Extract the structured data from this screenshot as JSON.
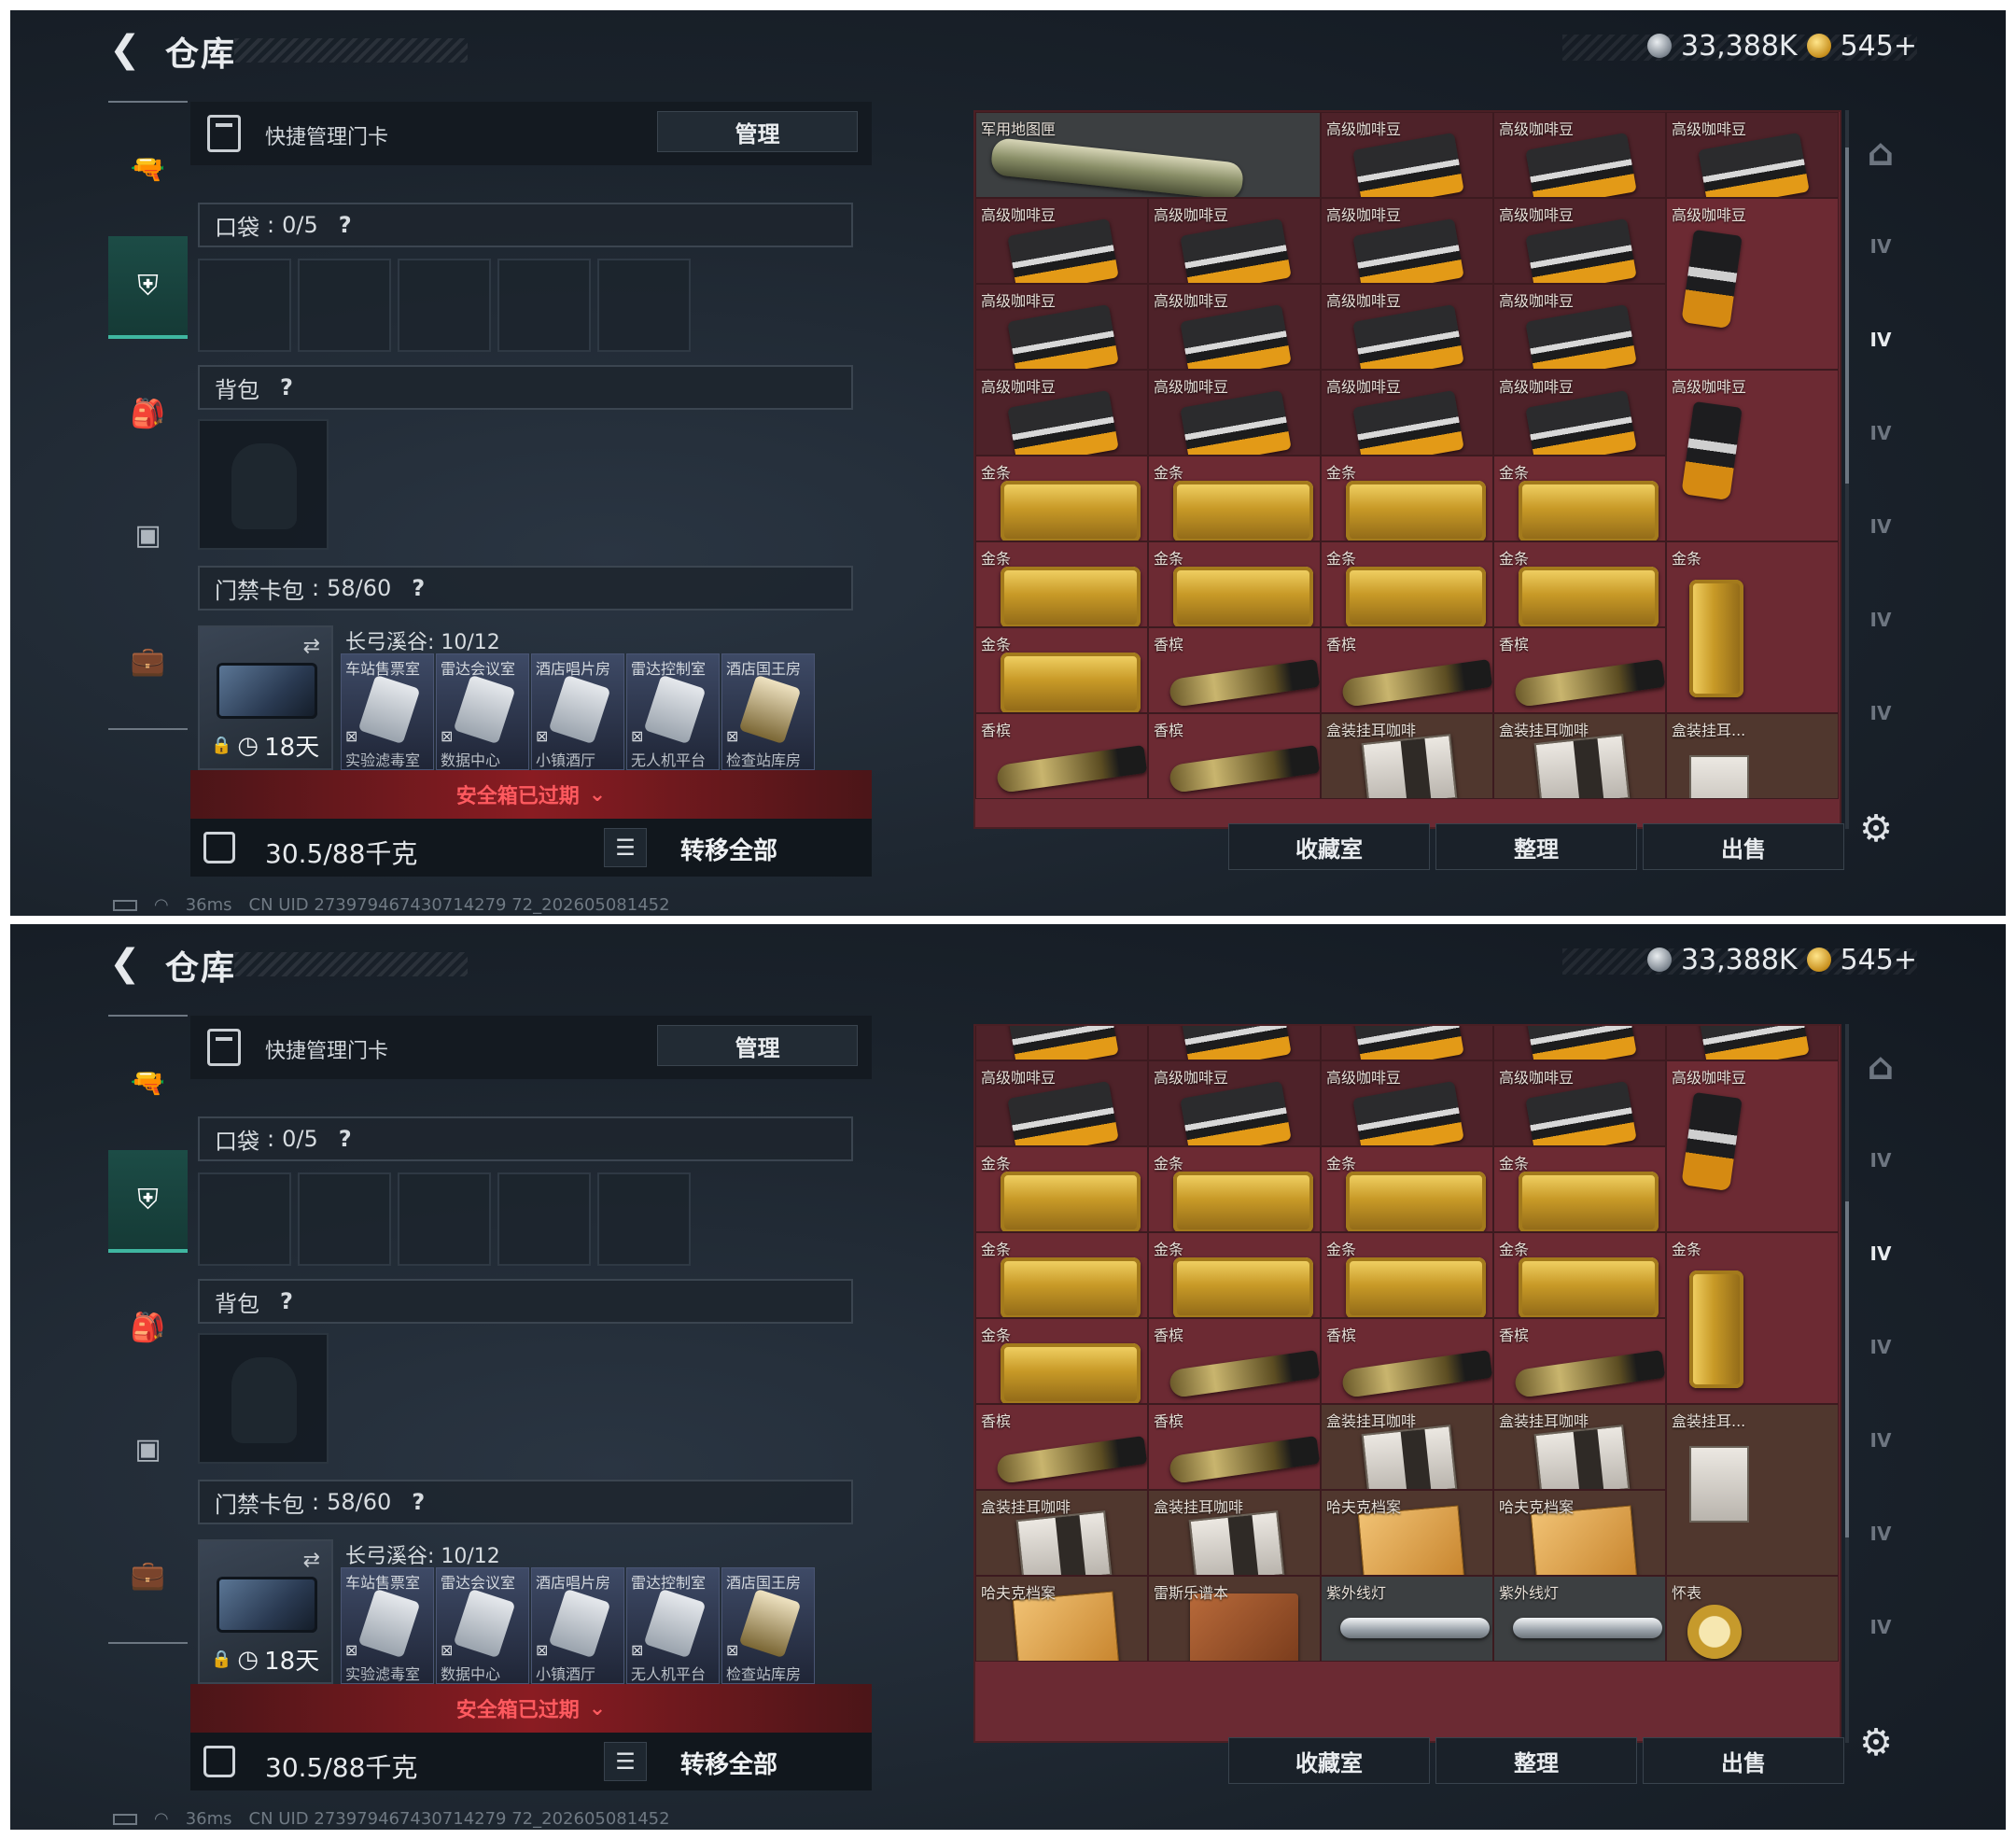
{
  "screens": [
    {
      "header": {
        "back_icon": "back-arrow-icon",
        "title": "仓库",
        "silver": "33,388K",
        "gold": "545+"
      },
      "sidebar": {
        "items": [
          "gun-icon",
          "armor-icon",
          "backpack-icon",
          "keycard-case-icon",
          "toolbox-icon"
        ],
        "active_index": 1
      },
      "quick_card": {
        "label": "快捷管理门卡",
        "manage": "管理"
      },
      "pocket": {
        "label": "口袋",
        "value": "0/5",
        "help": "?"
      },
      "backpack": {
        "label": "背包",
        "help": "?"
      },
      "keycard_bag": {
        "label": "门禁卡包",
        "value": "58/60",
        "help": "?"
      },
      "keycard_zone": {
        "title": "长弓溪谷: 10/12",
        "case_days": "18天",
        "cards": [
          {
            "name": "车站售票室",
            "sub": "实验滤毒室",
            "gold": false
          },
          {
            "name": "雷达会议室",
            "sub": "数据中心",
            "gold": false
          },
          {
            "name": "酒店唱片房",
            "sub": "小镇酒厅",
            "gold": false
          },
          {
            "name": "雷达控制室",
            "sub": "无人机平台",
            "gold": false
          },
          {
            "name": "酒店国王房",
            "sub": "检查站库房",
            "gold": true
          }
        ]
      },
      "expired": "安全箱已过期",
      "footer": {
        "weight": "30.5/88千克",
        "transfer": "转移全部"
      },
      "grid_items": [
        {
          "name": "军用地图匣",
          "kind": "map"
        },
        {
          "name": "高级咖啡豆",
          "kind": "coffee"
        },
        {
          "name": "高级咖啡豆",
          "kind": "coffee"
        },
        {
          "name": "高级咖啡豆",
          "kind": "coffee"
        },
        {
          "name": "高级咖啡豆",
          "kind": "coffee"
        },
        {
          "name": "高级咖啡豆",
          "kind": "coffee"
        },
        {
          "name": "高级咖啡豆",
          "kind": "coffee"
        },
        {
          "name": "高级咖啡豆",
          "kind": "coffee"
        },
        {
          "name": "高级咖啡豆",
          "kind": "coffee-tall"
        },
        {
          "name": "高级咖啡豆",
          "kind": "coffee"
        },
        {
          "name": "高级咖啡豆",
          "kind": "coffee"
        },
        {
          "name": "高级咖啡豆",
          "kind": "coffee"
        },
        {
          "name": "高级咖啡豆",
          "kind": "coffee"
        },
        {
          "name": "高级咖啡豆",
          "kind": "coffee"
        },
        {
          "name": "高级咖啡豆",
          "kind": "coffee"
        },
        {
          "name": "高级咖啡豆",
          "kind": "coffee"
        },
        {
          "name": "高级咖啡豆",
          "kind": "coffee"
        },
        {
          "name": "高级咖啡豆",
          "kind": "coffee-tall"
        },
        {
          "name": "金条",
          "kind": "gold"
        },
        {
          "name": "金条",
          "kind": "gold"
        },
        {
          "name": "金条",
          "kind": "gold"
        },
        {
          "name": "金条",
          "kind": "gold"
        },
        {
          "name": "金条",
          "kind": "gold"
        },
        {
          "name": "金条",
          "kind": "gold"
        },
        {
          "name": "金条",
          "kind": "gold"
        },
        {
          "name": "金条",
          "kind": "gold"
        },
        {
          "name": "金条",
          "kind": "gold-tall"
        },
        {
          "name": "金条",
          "kind": "gold"
        },
        {
          "name": "香槟",
          "kind": "champagne"
        },
        {
          "name": "香槟",
          "kind": "champagne"
        },
        {
          "name": "香槟",
          "kind": "champagne"
        },
        {
          "name": "香槟",
          "kind": "champagne"
        },
        {
          "name": "香槟",
          "kind": "champagne"
        },
        {
          "name": "盒装挂耳咖啡",
          "kind": "box"
        },
        {
          "name": "盒装挂耳咖啡",
          "kind": "box"
        },
        {
          "name": "盒装挂耳...",
          "kind": "box-tall"
        }
      ],
      "bottom": {
        "collect": "收藏室",
        "sort": "整理",
        "sell": "出售"
      },
      "status": {
        "ping": "36ms",
        "uid": "CN UID 273979467430714279 72_202605081452"
      }
    },
    {
      "header": {
        "back_icon": "back-arrow-icon",
        "title": "仓库",
        "silver": "33,388K",
        "gold": "545+"
      },
      "sidebar": {
        "items": [
          "gun-icon",
          "armor-icon",
          "backpack-icon",
          "keycard-case-icon",
          "toolbox-icon"
        ],
        "active_index": 1
      },
      "quick_card": {
        "label": "快捷管理门卡",
        "manage": "管理"
      },
      "pocket": {
        "label": "口袋",
        "value": "0/5",
        "help": "?"
      },
      "backpack": {
        "label": "背包",
        "help": "?"
      },
      "keycard_bag": {
        "label": "门禁卡包",
        "value": "58/60",
        "help": "?"
      },
      "keycard_zone": {
        "title": "长弓溪谷: 10/12",
        "case_days": "18天",
        "cards": [
          {
            "name": "车站售票室",
            "sub": "实验滤毒室",
            "gold": false
          },
          {
            "name": "雷达会议室",
            "sub": "数据中心",
            "gold": false
          },
          {
            "name": "酒店唱片房",
            "sub": "小镇酒厅",
            "gold": false
          },
          {
            "name": "雷达控制室",
            "sub": "无人机平台",
            "gold": false
          },
          {
            "name": "酒店国王房",
            "sub": "检查站库房",
            "gold": true
          }
        ]
      },
      "expired": "安全箱已过期",
      "footer": {
        "weight": "30.5/88千克",
        "transfer": "转移全部"
      },
      "grid_items": [
        {
          "name": "",
          "kind": "coffee"
        },
        {
          "name": "",
          "kind": "coffee"
        },
        {
          "name": "",
          "kind": "coffee"
        },
        {
          "name": "",
          "kind": "coffee"
        },
        {
          "name": "",
          "kind": "coffee"
        },
        {
          "name": "高级咖啡豆",
          "kind": "coffee"
        },
        {
          "name": "高级咖啡豆",
          "kind": "coffee"
        },
        {
          "name": "高级咖啡豆",
          "kind": "coffee"
        },
        {
          "name": "高级咖啡豆",
          "kind": "coffee"
        },
        {
          "name": "高级咖啡豆",
          "kind": "coffee-tall"
        },
        {
          "name": "金条",
          "kind": "gold"
        },
        {
          "name": "金条",
          "kind": "gold"
        },
        {
          "name": "金条",
          "kind": "gold"
        },
        {
          "name": "金条",
          "kind": "gold"
        },
        {
          "name": "金条",
          "kind": "gold"
        },
        {
          "name": "金条",
          "kind": "gold"
        },
        {
          "name": "金条",
          "kind": "gold"
        },
        {
          "name": "金条",
          "kind": "gold"
        },
        {
          "name": "金条",
          "kind": "gold-tall"
        },
        {
          "name": "金条",
          "kind": "gold"
        },
        {
          "name": "香槟",
          "kind": "champagne"
        },
        {
          "name": "香槟",
          "kind": "champagne"
        },
        {
          "name": "香槟",
          "kind": "champagne"
        },
        {
          "name": "香槟",
          "kind": "champagne"
        },
        {
          "name": "香槟",
          "kind": "champagne"
        },
        {
          "name": "盒装挂耳咖啡",
          "kind": "box"
        },
        {
          "name": "盒装挂耳咖啡",
          "kind": "box"
        },
        {
          "name": "盒装挂耳...",
          "kind": "box-tall"
        },
        {
          "name": "盒装挂耳咖啡",
          "kind": "box"
        },
        {
          "name": "盒装挂耳咖啡",
          "kind": "box"
        },
        {
          "name": "哈夫克档案",
          "kind": "folder"
        },
        {
          "name": "哈夫克档案",
          "kind": "folder"
        },
        {
          "name": "哈夫克档案",
          "kind": "folder"
        },
        {
          "name": "雷斯乐谱本",
          "kind": "book"
        },
        {
          "name": "紫外线灯",
          "kind": "uv"
        },
        {
          "name": "紫外线灯",
          "kind": "uv"
        },
        {
          "name": "怀表",
          "kind": "watch"
        }
      ],
      "bottom": {
        "collect": "收藏室",
        "sort": "整理",
        "sell": "出售"
      },
      "status": {
        "ping": "36ms",
        "uid": "CN UID 273979467430714279 72_202605081452"
      }
    }
  ],
  "right_tabs": [
    "vault-icon",
    "IV",
    "IV",
    "IV",
    "IV",
    "IV",
    "IV"
  ]
}
